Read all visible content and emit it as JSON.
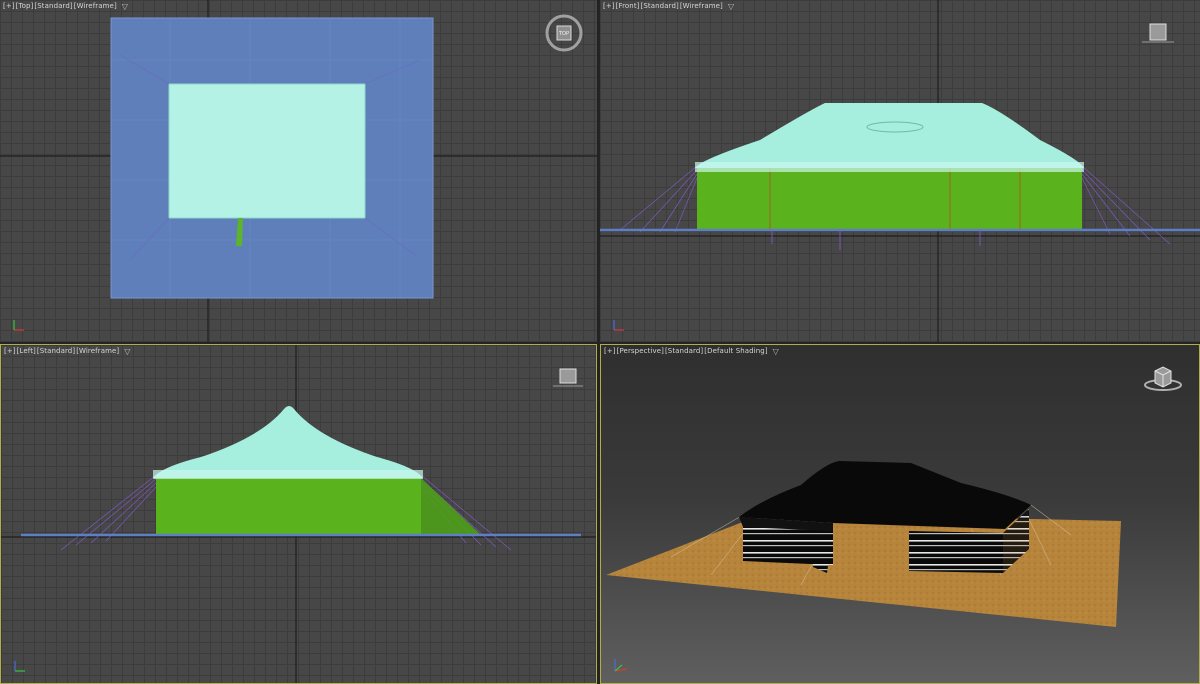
{
  "viewports": {
    "top": {
      "label": [
        "[+]",
        "[Top]",
        "[Standard]",
        "[Wireframe]"
      ]
    },
    "front": {
      "label": [
        "[+]",
        "[Front]",
        "[Standard]",
        "[Wireframe]"
      ]
    },
    "left": {
      "label": [
        "[+]",
        "[Left]",
        "[Standard]",
        "[Wireframe]"
      ]
    },
    "perspective": {
      "label": [
        "[+]",
        "[Perspective]",
        "[Standard]",
        "[Default Shading]"
      ]
    }
  },
  "icons": {
    "filter": "filter-funnel-icon",
    "viewcube": "viewcube-icon",
    "axis": "axis-tripod-icon"
  },
  "colors": {
    "viewport_bg": "#474747",
    "grid": "#3c3c3c",
    "active_border": "#b1ad4a",
    "ground_wire": "#5d7fc3",
    "tent_roof_wire": "#a6f0e0",
    "tent_wall_wire": "#5bb42a",
    "guy_lines": "#8a5ad0",
    "ground_plane_shaded": "#b7843c"
  }
}
